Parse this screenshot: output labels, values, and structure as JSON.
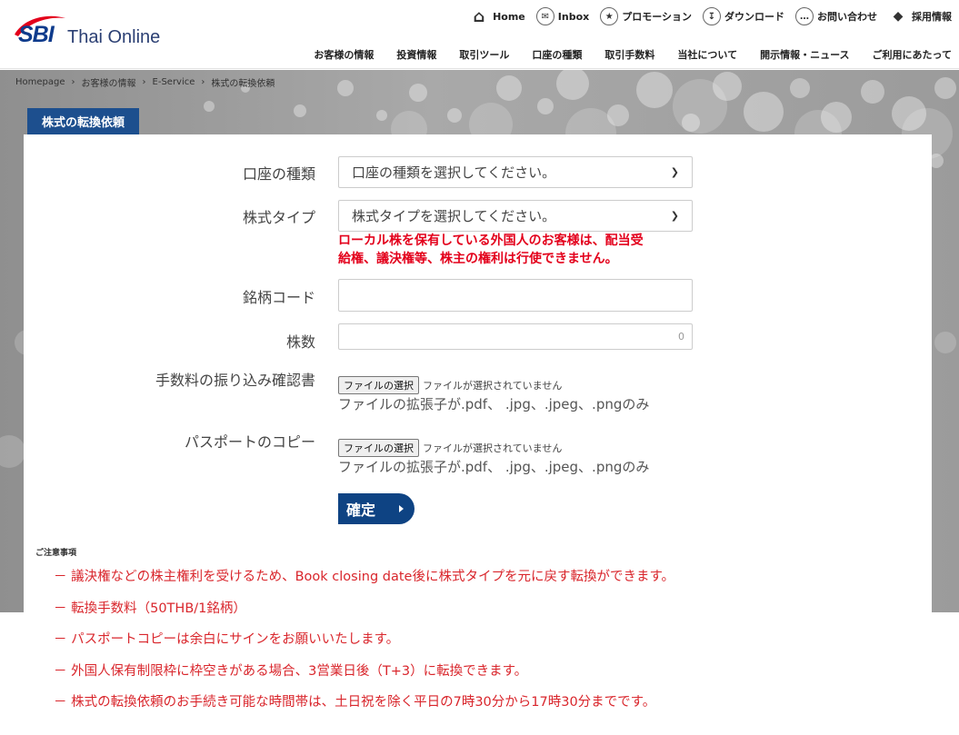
{
  "logo": {
    "brand": "SBI",
    "name": "Thai Online"
  },
  "top_nav": [
    {
      "label": "Home",
      "icon": "home-icon"
    },
    {
      "label": "Inbox",
      "icon": "inbox-icon"
    },
    {
      "label": "プロモーション",
      "icon": "star-icon"
    },
    {
      "label": "ダウンロード",
      "icon": "download-icon"
    },
    {
      "label": "お問い合わせ",
      "icon": "chat-icon"
    },
    {
      "label": "採用情報",
      "icon": "handshake-icon"
    }
  ],
  "main_nav": [
    "お客様の情報",
    "投資情報",
    "取引ツール",
    "口座の種類",
    "取引手数料",
    "当社について",
    "開示情報・ニュース",
    "ご利用にあたって"
  ],
  "breadcrumb": [
    "Homepage",
    "お客様の情報",
    "E-Service",
    "株式の転換依頼"
  ],
  "page_title": "株式の転換依頼",
  "form": {
    "account_type": {
      "label": "口座の種類",
      "selected": "口座の種類を選択してください。"
    },
    "stock_type": {
      "label": "株式タイプ",
      "selected": "株式タイプを選択してください。"
    },
    "warning_line1": "ローカル株を保有している外国人のお客様は、配当受",
    "warning_line2": "給権、議決権等、株主の権利は行使できません。",
    "symbol": {
      "label": "銘柄コード",
      "value": ""
    },
    "shares": {
      "label": "株数",
      "value": "0"
    },
    "fee_receipt": {
      "label": "手数料の振り込み確認書",
      "button": "ファイルの選択",
      "status": "ファイルが選択されていません",
      "note": "ファイルの拡張子が.pdf、 .jpg、.jpeg、.pngのみ"
    },
    "passport": {
      "label": "パスポートのコピー",
      "button": "ファイルの選択",
      "status": "ファイルが選択されていません",
      "note": "ファイルの拡張子が.pdf、 .jpg、.jpeg、.pngのみ"
    },
    "submit": "確定"
  },
  "notes": {
    "title": "ご注意事項",
    "items": [
      "－ 議決権などの株主権利を受けるため、Book closing date後に株式タイプを元に戻す転換ができます。",
      "－ 転換手数料（50THB/1銘柄）",
      "－ パスポートコピーは余白にサインをお願いいたします。",
      "－ 外国人保有制限枠に枠空きがある場合、3営業日後（T+3）に転換できます。",
      "－ 株式の転換依頼のお手続き可能な時間帯は、土日祝を除く平日の7時30分から17時30分までです。"
    ]
  },
  "colors": {
    "brand_blue": "#1d4f8e",
    "submit_blue": "#0e4383",
    "warning_red": "#e3001b",
    "note_red": "#d9262c"
  }
}
